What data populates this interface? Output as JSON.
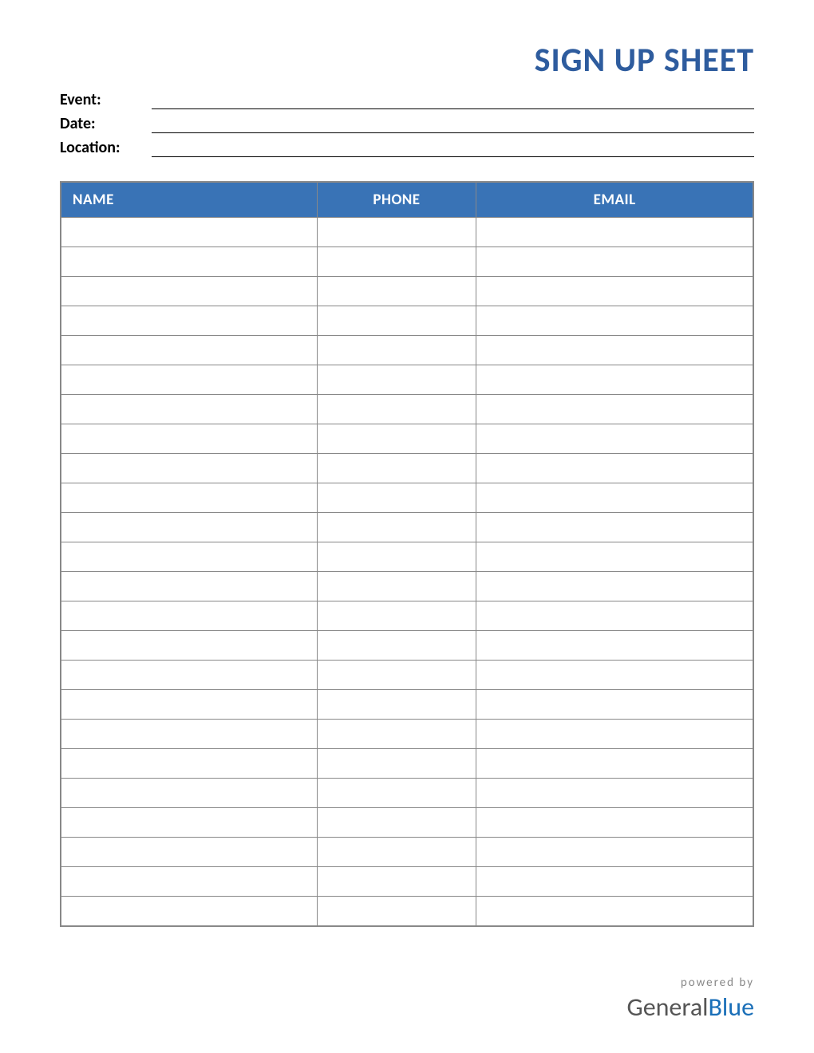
{
  "title": "SIGN UP SHEET",
  "info": {
    "fields": [
      {
        "label": "Event:",
        "value": ""
      },
      {
        "label": "Date:",
        "value": ""
      },
      {
        "label": "Location:",
        "value": ""
      }
    ]
  },
  "table": {
    "headers": {
      "name": "NAME",
      "phone": "PHONE",
      "email": "EMAIL"
    },
    "rows": [
      {
        "name": "",
        "phone": "",
        "email": ""
      },
      {
        "name": "",
        "phone": "",
        "email": ""
      },
      {
        "name": "",
        "phone": "",
        "email": ""
      },
      {
        "name": "",
        "phone": "",
        "email": ""
      },
      {
        "name": "",
        "phone": "",
        "email": ""
      },
      {
        "name": "",
        "phone": "",
        "email": ""
      },
      {
        "name": "",
        "phone": "",
        "email": ""
      },
      {
        "name": "",
        "phone": "",
        "email": ""
      },
      {
        "name": "",
        "phone": "",
        "email": ""
      },
      {
        "name": "",
        "phone": "",
        "email": ""
      },
      {
        "name": "",
        "phone": "",
        "email": ""
      },
      {
        "name": "",
        "phone": "",
        "email": ""
      },
      {
        "name": "",
        "phone": "",
        "email": ""
      },
      {
        "name": "",
        "phone": "",
        "email": ""
      },
      {
        "name": "",
        "phone": "",
        "email": ""
      },
      {
        "name": "",
        "phone": "",
        "email": ""
      },
      {
        "name": "",
        "phone": "",
        "email": ""
      },
      {
        "name": "",
        "phone": "",
        "email": ""
      },
      {
        "name": "",
        "phone": "",
        "email": ""
      },
      {
        "name": "",
        "phone": "",
        "email": ""
      },
      {
        "name": "",
        "phone": "",
        "email": ""
      },
      {
        "name": "",
        "phone": "",
        "email": ""
      },
      {
        "name": "",
        "phone": "",
        "email": ""
      },
      {
        "name": "",
        "phone": "",
        "email": ""
      }
    ]
  },
  "footer": {
    "powered": "powered by",
    "brand1": "General",
    "brand2": "Blue"
  }
}
